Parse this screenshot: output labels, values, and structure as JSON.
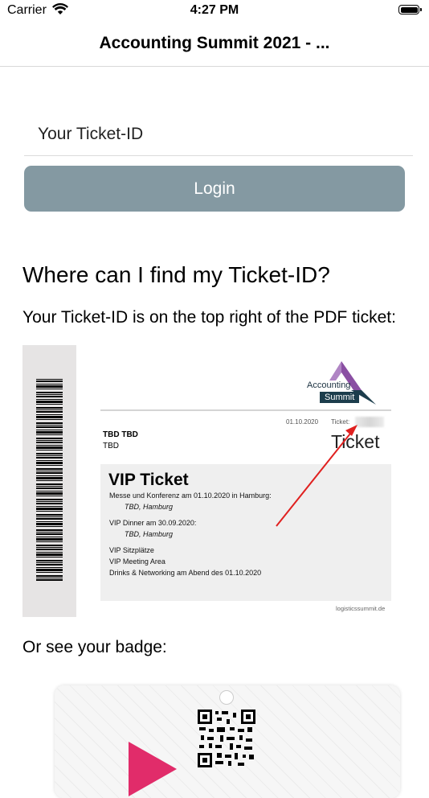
{
  "status_bar": {
    "carrier": "Carrier",
    "time": "4:27 PM"
  },
  "nav": {
    "title": "Accounting Summit 2021 - ..."
  },
  "login_form": {
    "ticket_placeholder": "Your Ticket-ID",
    "login_label": "Login"
  },
  "help": {
    "heading": "Where can I find my Ticket-ID?",
    "text": "Your Ticket-ID is on the top right of the PDF ticket:",
    "badge_text": "Or see your badge:"
  },
  "ticket_image": {
    "logo_line1": "Accounting",
    "logo_line2": "Summit",
    "date": "01.10.2020",
    "ticket_label": "Ticket:",
    "holder_name": "TBD TBD",
    "holder_company": "TBD",
    "ticket_word": "Ticket",
    "vip_title": "VIP Ticket",
    "lines": [
      "Messe und Konferenz am 01.10.2020 in Hamburg:",
      "TBD, Hamburg",
      "VIP Dinner am 30.09.2020:",
      "TBD, Hamburg",
      "VIP Sitzplätze",
      "VIP Meeting Area",
      "Drinks & Networking am Abend des 01.10.2020"
    ],
    "website": "logisticssummit.de"
  },
  "colors": {
    "login_button": "#8499a2",
    "arrow": "#e0201f",
    "badge_accent": "#e12c6a"
  }
}
